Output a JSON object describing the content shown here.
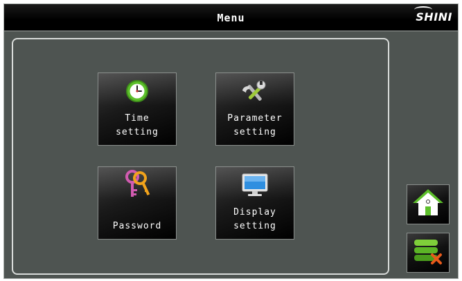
{
  "header": {
    "title": "Menu",
    "logo_text": "SHINI"
  },
  "menu": {
    "time_setting": {
      "label": "Time\nsetting",
      "icon": "clock-icon"
    },
    "parameter_setting": {
      "label": "Parameter\nsetting",
      "icon": "tools-icon"
    },
    "password": {
      "label": "Password",
      "icon": "keys-icon"
    },
    "display_setting": {
      "label": "Display\nsetting",
      "icon": "monitor-icon"
    }
  },
  "side_buttons": [
    {
      "icon": "home-icon"
    },
    {
      "icon": "database-delete-icon"
    }
  ],
  "colors": {
    "background": "#4e5451",
    "titlebar": "#000000",
    "tile": "#1a1a1a",
    "text": "#ffffff",
    "accent_green": "#5cbf2a"
  }
}
